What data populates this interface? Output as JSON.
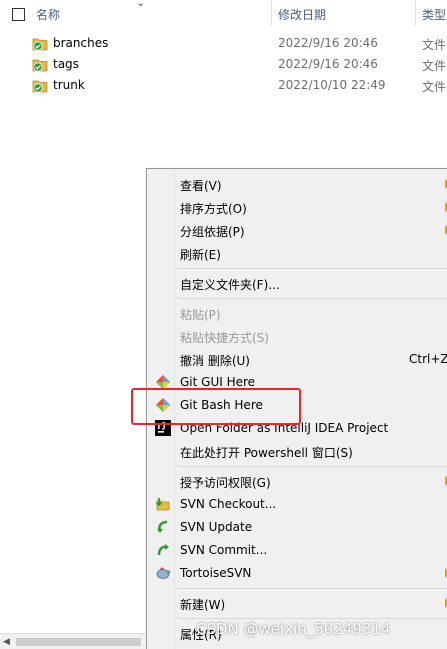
{
  "explorer": {
    "columns": {
      "name": "名称",
      "date": "修改日期",
      "type": "类型"
    },
    "files": [
      {
        "name": "branches",
        "date": "2022/9/16 20:46",
        "type": "文件"
      },
      {
        "name": "tags",
        "date": "2022/9/16 20:46",
        "type": "文件"
      },
      {
        "name": "trunk",
        "date": "2022/10/10 22:49",
        "type": "文件"
      }
    ]
  },
  "context_menu": {
    "view": "查看(V)",
    "sort": "排序方式(O)",
    "group": "分组依据(P)",
    "refresh": "刷新(E)",
    "customize": "自定义文件夹(F)...",
    "paste": "粘贴(P)",
    "paste_shortcut": "粘贴快捷方式(S)",
    "undo_delete": "撤消 删除(U)",
    "undo_shortcut": "Ctrl+Z",
    "git_gui": "Git GUI Here",
    "git_bash": "Git Bash Here",
    "intellij": "Open Folder as IntelliJ IDEA Project",
    "powershell": "在此处打开 Powershell 窗口(S)",
    "grant_access": "授予访问权限(G)",
    "svn_checkout": "SVN Checkout...",
    "svn_update": "SVN Update",
    "svn_commit": "SVN Commit...",
    "tortoise": "TortoiseSVN",
    "new": "新建(W)",
    "properties": "属性(R)"
  },
  "watermark": "CSDN @weixin_50249314",
  "colors": {
    "highlight": "#e8262c",
    "svn_green": "#2e9a2e",
    "folder_yellow": "#e6b84a"
  }
}
